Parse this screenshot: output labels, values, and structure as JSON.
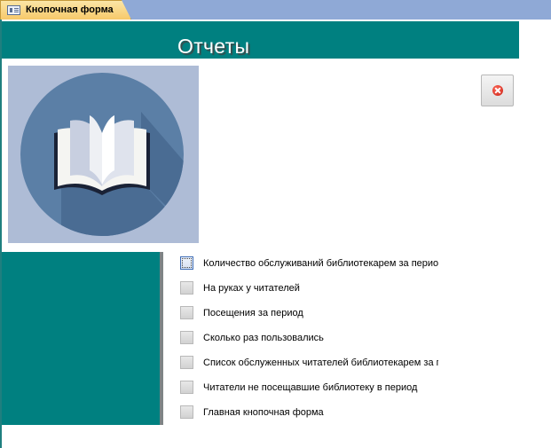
{
  "tab": {
    "label": "Кнопочная форма",
    "icon": "form-icon"
  },
  "header": {
    "title": "Отчеты"
  },
  "image": {
    "icon": "open-book-icon",
    "bg_color": "#aebcd6",
    "circle_color": "#5b7fa6"
  },
  "close_button": {
    "icon": "close-icon"
  },
  "colors": {
    "teal": "#008080",
    "tab_bar": "#8fa9d6",
    "tab_active": "#f7c96a"
  },
  "menu": {
    "items": [
      {
        "label": "Количество обслуживаний библиотекарем за период",
        "focused": true
      },
      {
        "label": "На руках у читателей"
      },
      {
        "label": "Посещения за период"
      },
      {
        "label": "Сколько раз пользовались"
      },
      {
        "label": "Список обслуженных читателей библиотекарем за период"
      },
      {
        "label": "Читатели не посещавшие библиотеку в период"
      },
      {
        "label": "Главная кнопочная форма"
      }
    ]
  }
}
